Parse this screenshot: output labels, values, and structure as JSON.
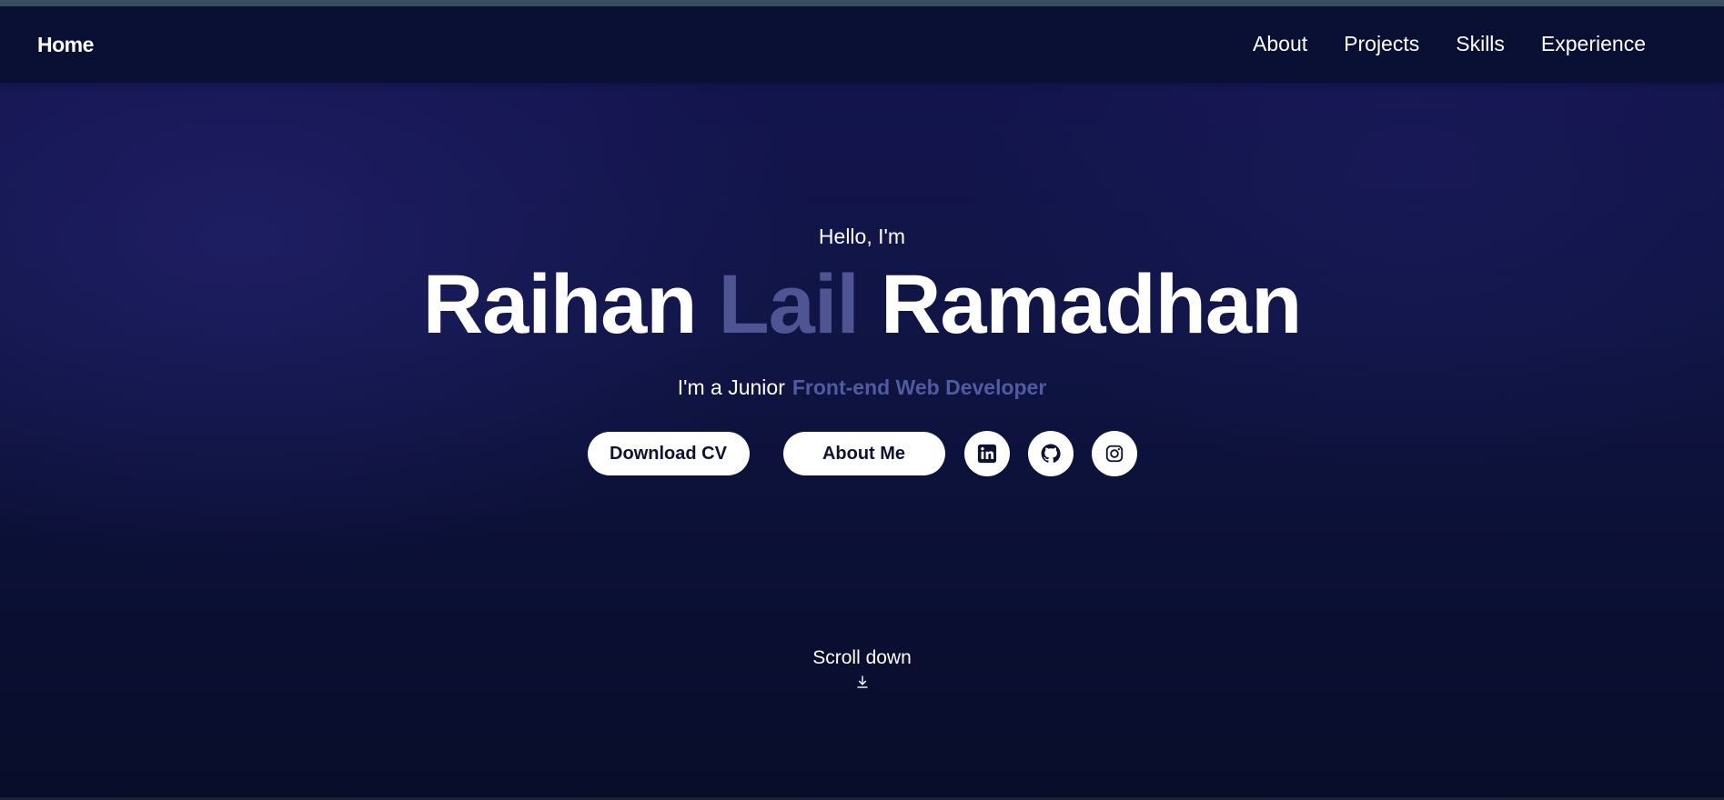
{
  "nav": {
    "home": "Home",
    "links": [
      "About",
      "Projects",
      "Skills",
      "Experience"
    ]
  },
  "hero": {
    "greeting": "Hello, I'm",
    "name_first": "Raihan",
    "name_middle": "Lail",
    "name_last": "Ramadhan",
    "subtitle_prefix": "I'm a Junior",
    "subtitle_role": "Front-end Web Developer",
    "buttons": {
      "download_cv": "Download CV",
      "about_me": "About Me"
    },
    "socials": [
      "linkedin-icon",
      "github-icon",
      "instagram-icon"
    ]
  },
  "scroll": {
    "label": "Scroll down",
    "icon": "download-arrow-icon"
  },
  "colors": {
    "background": "#101545",
    "navbar": "#0a1033",
    "accent": "#4e5592",
    "button_bg": "#ffffff",
    "button_text": "#0d1233"
  }
}
